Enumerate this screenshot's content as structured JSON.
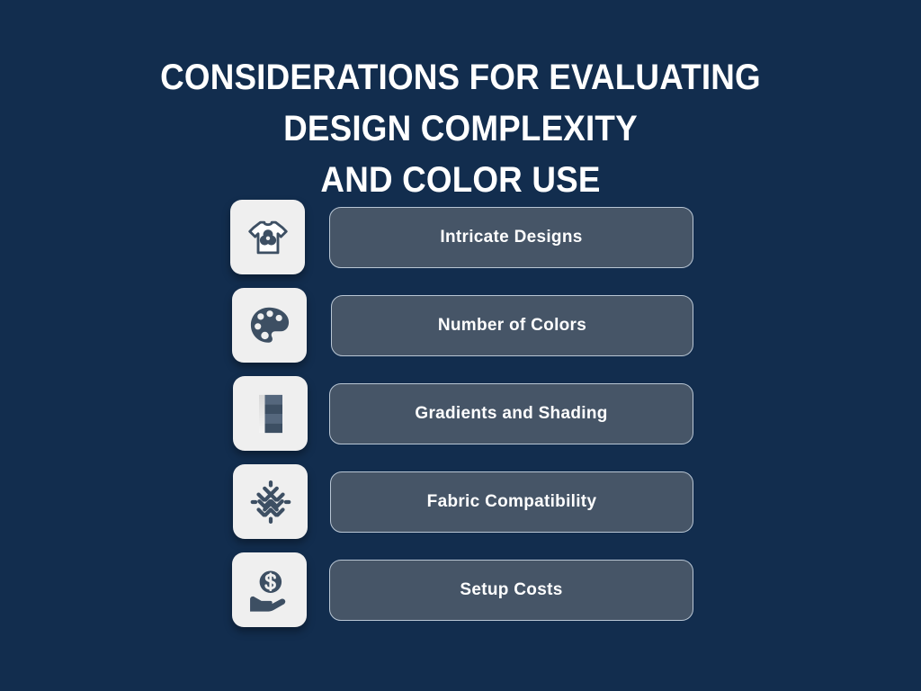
{
  "theme": {
    "background_color": "#122d4e",
    "tile_color": "#efefef",
    "icon_color": "#3d4f63",
    "pill_fill_color": "#465567",
    "pill_border_color": "#b9c6d4",
    "text_color": "#ffffff"
  },
  "header": {
    "title": "CONSIDERATIONS FOR EVALUATING DESIGN COMPLEXITY\nAND COLOR USE"
  },
  "items": [
    {
      "label": "Intricate Designs",
      "icon": "tshirt-color-wheel-icon"
    },
    {
      "label": "Number of Colors",
      "icon": "paint-palette-icon"
    },
    {
      "label": "Gradients and Shading",
      "icon": "gradient-swatch-strip-icon"
    },
    {
      "label": "Fabric Compatibility",
      "icon": "woven-fabric-texture-icon"
    },
    {
      "label": "Setup Costs",
      "icon": "hand-holding-dollar-icon"
    }
  ]
}
